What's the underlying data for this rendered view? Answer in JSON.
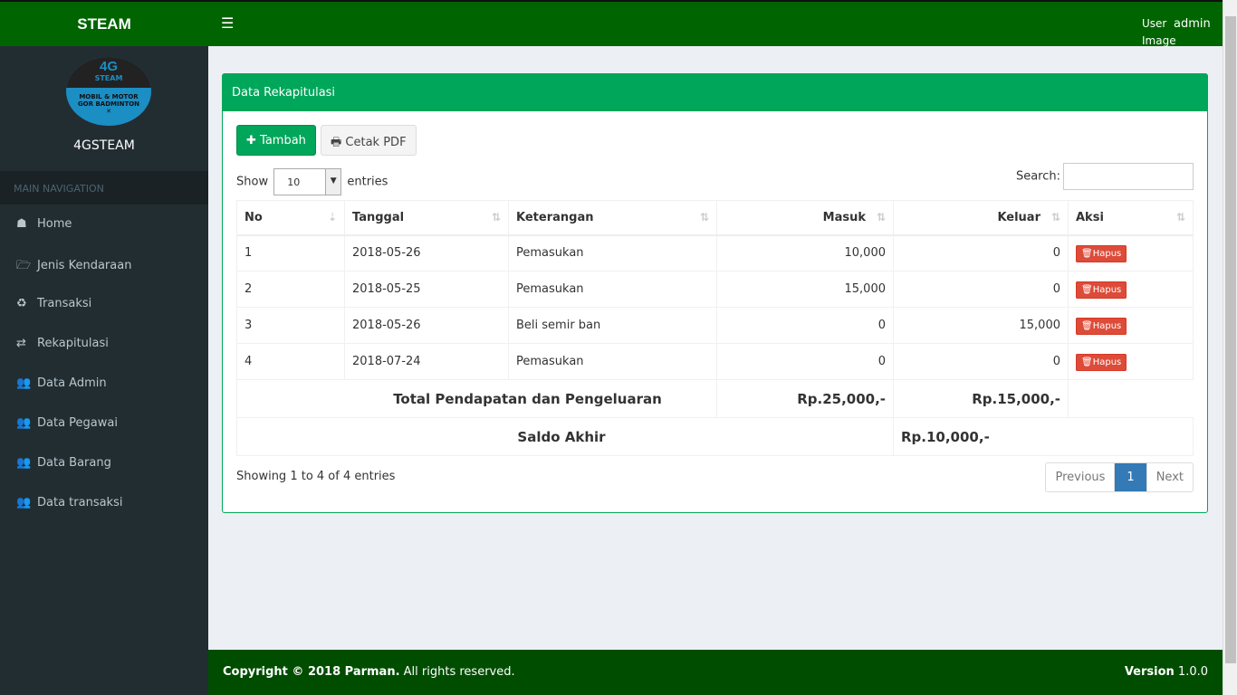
{
  "header": {
    "brand": "STEAM",
    "menu_icon": "hamburger-icon",
    "user_image_alt": "User Image",
    "username": "admin"
  },
  "sidebar": {
    "logo_text": [
      "4G",
      "STEAM",
      "MOBIL & MOTOR",
      "GOR BADMINTON"
    ],
    "site_name": "4GSTEAM",
    "nav_header": "MAIN NAVIGATION",
    "items": [
      {
        "icon": "dashboard-icon",
        "glyph": "☗",
        "label": "Home"
      },
      {
        "icon": "folder-open-icon",
        "glyph": "🗁",
        "label": "Jenis Kendaraan"
      },
      {
        "icon": "recycle-icon",
        "glyph": "♻",
        "label": "Transaksi"
      },
      {
        "icon": "exchange-icon",
        "glyph": "⇄",
        "label": "Rekapitulasi"
      },
      {
        "icon": "users-icon",
        "glyph": "👥",
        "label": "Data Admin"
      },
      {
        "icon": "users-icon",
        "glyph": "👥",
        "label": "Data Pegawai"
      },
      {
        "icon": "users-icon",
        "glyph": "👥",
        "label": "Data Barang"
      },
      {
        "icon": "users-icon",
        "glyph": "👥",
        "label": "Data transaksi"
      }
    ]
  },
  "box": {
    "title": "Data Rekapitulasi",
    "add_label": "Tambah",
    "pdf_label": "Cetak PDF",
    "show_label": "Show",
    "entries_value": "10",
    "entries_label": "entries",
    "search_label": "Search:",
    "search_value": ""
  },
  "table": {
    "headers": [
      "No",
      "Tanggal",
      "Keterangan",
      "Masuk",
      "Keluar",
      "Aksi"
    ],
    "rows": [
      [
        "1",
        "2018-05-26",
        "Pemasukan",
        "10,000",
        "0"
      ],
      [
        "2",
        "2018-05-25",
        "Pemasukan",
        "15,000",
        "0"
      ],
      [
        "3",
        "2018-05-26",
        "Beli semir ban",
        "0",
        "15,000"
      ],
      [
        "4",
        "2018-07-24",
        "Pemasukan",
        "0",
        "0"
      ]
    ],
    "action_label": "Hapus",
    "total_label": "Total Pendapatan dan Pengeluaran",
    "total_masuk": "Rp.25,000,-",
    "total_keluar": "Rp.15,000,-",
    "saldo_label": "Saldo Akhir",
    "saldo_value": "Rp.10,000,-"
  },
  "pagination": {
    "info": "Showing 1 to 4 of 4 entries",
    "previous": "Previous",
    "current": "1",
    "next": "Next"
  },
  "footer": {
    "copyright_prefix": "Copyright © 2018 Parman.",
    "copyright_suffix": " All rights reserved.",
    "version_label": "Version",
    "version": "1.0.0"
  },
  "colors": {
    "header": "#006400",
    "box_accent": "#00a65a",
    "danger": "#dd4b39",
    "sidebar": "#222d32",
    "footer": "#004d00"
  }
}
